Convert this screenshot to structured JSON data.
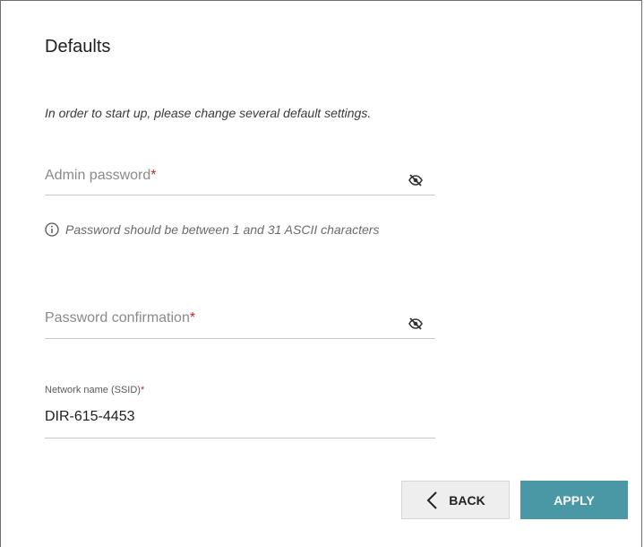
{
  "page": {
    "title": "Defaults",
    "intro": "In order to start up, please change several default settings."
  },
  "fields": {
    "admin_password": {
      "label": "Admin password",
      "required_mark": "*",
      "value": "",
      "visibility_icon": "eye-off-icon"
    },
    "password_hint": "Password should be between 1 and 31 ASCII characters",
    "password_confirmation": {
      "label": "Password confirmation",
      "required_mark": "*",
      "value": "",
      "visibility_icon": "eye-off-icon"
    },
    "ssid": {
      "label": "Network name (SSID)",
      "required_mark": "*",
      "value": "DIR-615-4453"
    }
  },
  "buttons": {
    "back_label": "BACK",
    "apply_label": "APPLY"
  },
  "colors": {
    "accent": "#4a97a6",
    "required": "#c62828"
  }
}
